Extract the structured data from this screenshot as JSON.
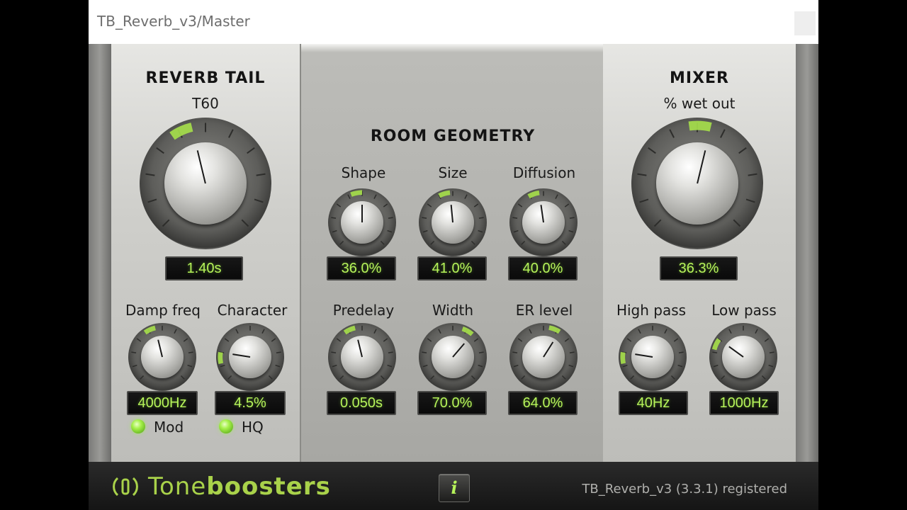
{
  "window": {
    "title": "TB_Reverb_v3/Master"
  },
  "reverb_tail": {
    "title": "REVERB TAIL",
    "t60": {
      "label": "T60",
      "value": "1.40s"
    },
    "damp_freq": {
      "label": "Damp freq",
      "value": "4000Hz"
    },
    "character": {
      "label": "Character",
      "value": "4.5%"
    },
    "mod": {
      "label": "Mod",
      "on": true
    },
    "hq": {
      "label": "HQ",
      "on": true
    }
  },
  "room_geometry": {
    "title": "ROOM GEOMETRY",
    "shape": {
      "label": "Shape",
      "value": "36.0%"
    },
    "size": {
      "label": "Size",
      "value": "41.0%"
    },
    "diffusion": {
      "label": "Diffusion",
      "value": "40.0%"
    },
    "predelay": {
      "label": "Predelay",
      "value": "0.050s"
    },
    "width": {
      "label": "Width",
      "value": "70.0%"
    },
    "er_level": {
      "label": "ER level",
      "value": "64.0%"
    }
  },
  "mixer": {
    "title": "MIXER",
    "wet_out": {
      "label": "% wet out",
      "value": "36.3%"
    },
    "high_pass": {
      "label": "High pass",
      "value": "40Hz"
    },
    "low_pass": {
      "label": "Low pass",
      "value": "1000Hz"
    }
  },
  "footer": {
    "brand_light": "Tone",
    "brand_bold": "boosters",
    "info_label": "i",
    "version": "TB_Reverb_v3 (3.3.1) registered"
  },
  "colors": {
    "lcd_text": "#b6f35a",
    "led_on": "#a5f04a",
    "brand": "#a9d24a"
  },
  "knob_levels": {
    "t60": 0.45,
    "wet_out": 0.55,
    "damp_freq": 0.45,
    "character": 0.2,
    "shape": 0.5,
    "size": 0.48,
    "diffusion": 0.47,
    "predelay": 0.45,
    "width": 0.65,
    "er_level": 0.62,
    "high_pass": 0.2,
    "low_pass": 0.3
  }
}
